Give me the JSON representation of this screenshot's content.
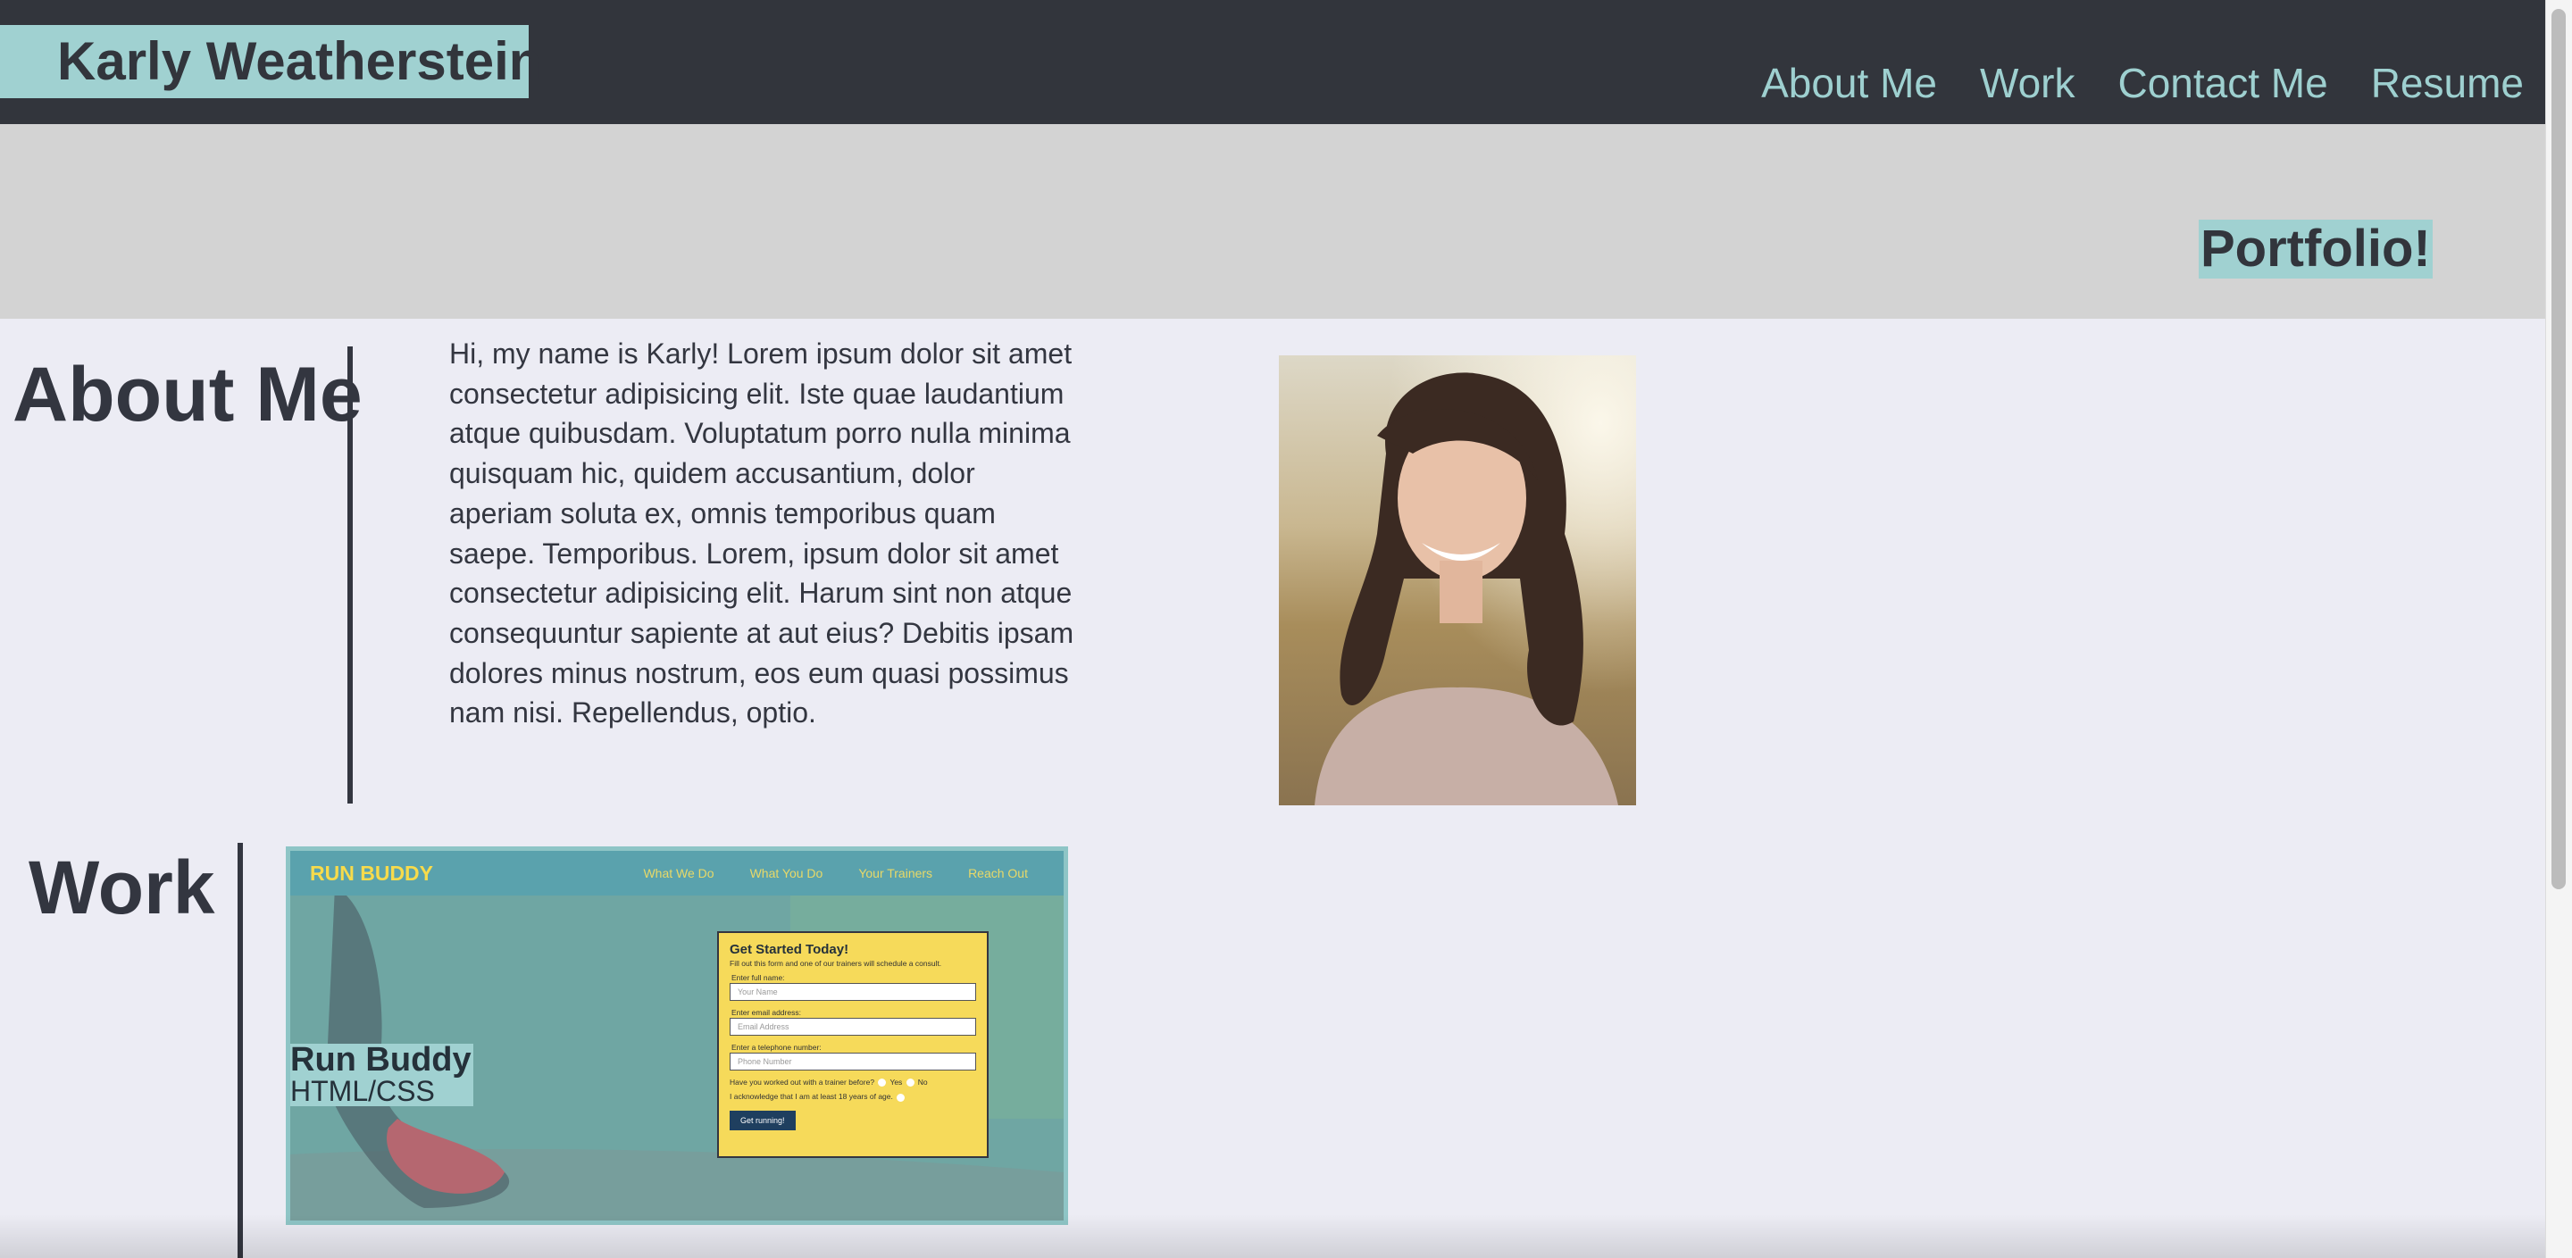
{
  "header": {
    "brand": "Karly Weatherstein",
    "nav": [
      "About Me",
      "Work",
      "Contact Me",
      "Resume"
    ]
  },
  "hero": {
    "title": "Portfolio!"
  },
  "about": {
    "heading": "About Me",
    "text": "Hi, my name is Karly! Lorem ipsum dolor sit amet consectetur adipisicing elit. Iste quae laudantium atque quibusdam. Voluptatum porro nulla minima quisquam hic, quidem accusantium, dolor aperiam soluta ex, omnis temporibus quam saepe. Temporibus. Lorem, ipsum dolor sit amet consectetur adipisicing elit. Harum sint non atque consequuntur sapiente at aut eius? Debitis ipsam dolores minus nostrum, eos eum quasi possimus nam nisi. Repellendus, optio."
  },
  "work": {
    "heading": "Work",
    "project": {
      "name": "Run Buddy",
      "tech": "HTML/CSS",
      "screenshot": {
        "logo": "RUN BUDDY",
        "nav": [
          "What We Do",
          "What You Do",
          "Your Trainers",
          "Reach Out"
        ],
        "form_title": "Get Started Today!",
        "form_subtitle": "Fill out this form and one of our trainers will schedule a consult.",
        "fields": [
          {
            "label": "Enter full name:",
            "placeholder": "Your Name"
          },
          {
            "label": "Enter email address:",
            "placeholder": "Email Address"
          },
          {
            "label": "Enter a telephone number:",
            "placeholder": "Phone Number"
          }
        ],
        "question": "Have you worked out with a trainer before?",
        "yes": "Yes",
        "no": "No",
        "acknowledge": "I acknowledge that I am at least 18 years of age.",
        "button": "Get running!"
      }
    }
  },
  "colors": {
    "header_bg": "#32353c",
    "accent": "#a0d1d1",
    "hero_bg": "#d3d3d3",
    "page_bg": "#ececf4",
    "text": "#333640"
  }
}
